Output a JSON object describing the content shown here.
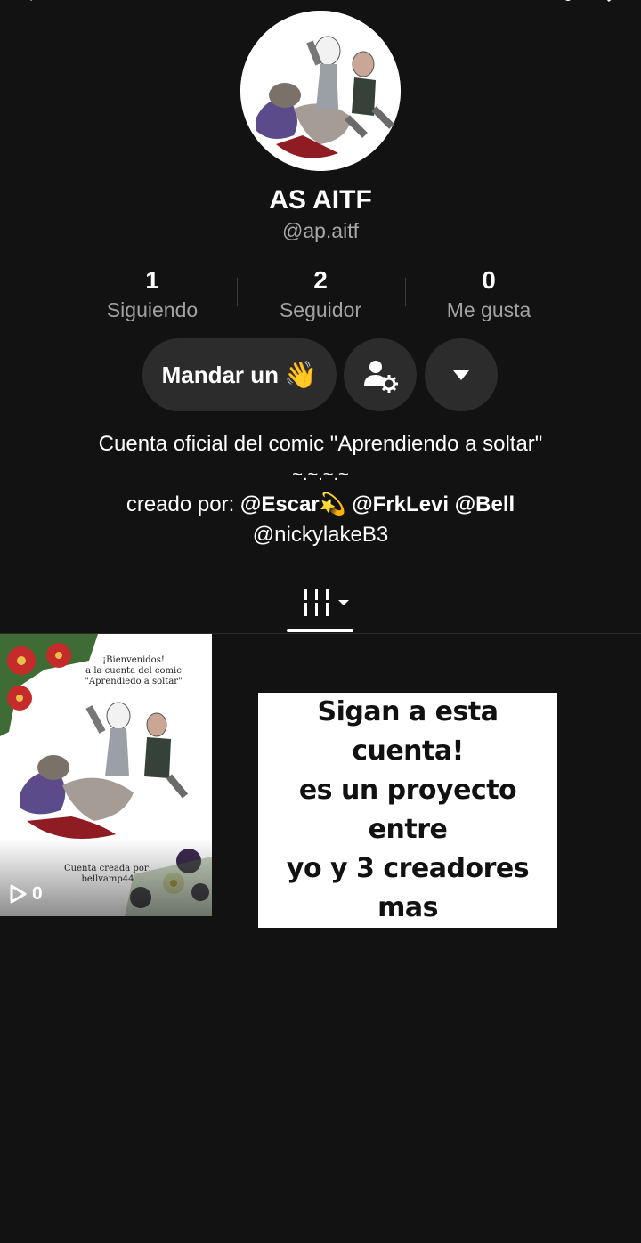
{
  "profile": {
    "display_name": "AS AITF",
    "handle": "@ap.aitf"
  },
  "stats": [
    {
      "value": "1",
      "label": "Siguiendo"
    },
    {
      "value": "2",
      "label": "Seguidor"
    },
    {
      "value": "0",
      "label": "Me gusta"
    }
  ],
  "actions": {
    "wave_label": "Mandar un",
    "wave_emoji": "👋"
  },
  "bio": {
    "line1": "Cuenta oficial del comic \"Aprendiendo a soltar\"",
    "line2": "~.~.~.~",
    "line3_prefix": "creado por: ",
    "mentions": [
      "@Escar💫",
      "@FrkLevi",
      "@Bell"
    ],
    "line4": "@nickylakeB3"
  },
  "tabs": {
    "active_icon": "grid-filter-icon"
  },
  "video": {
    "thumb_welcome": "¡Bienvenidos!",
    "thumb_line2": "a la cuenta del comic",
    "thumb_line3": "\"Aprendiedo a soltar\"",
    "thumb_credit1": "Cuenta creada por:",
    "thumb_credit2": "bellvamp44",
    "views": "0",
    "caption_lines": [
      "Sigan a esta cuenta!",
      "es un proyecto entre",
      "yo y 3 creadores mas"
    ]
  },
  "colors": {
    "background": "#121212",
    "button": "#2c2c2c",
    "muted_text": "#a2a2a2"
  }
}
